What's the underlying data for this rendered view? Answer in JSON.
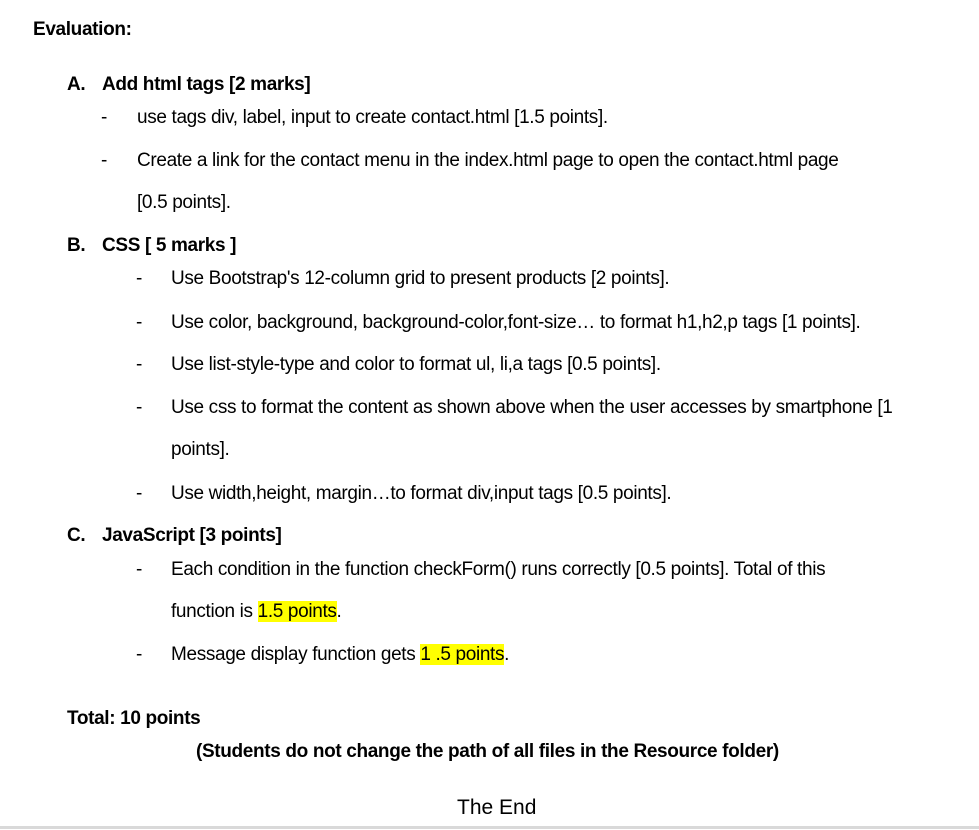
{
  "heading": "Evaluation:",
  "section_a": {
    "label": "A.",
    "title": "Add html tags [2 marks]",
    "items": [
      "use tags div, label, input to create contact.html [1.5 points].",
      "Create a link for the contact menu in the index.html page  to open the contact.html page",
      "[0.5 points]."
    ]
  },
  "section_b": {
    "label": "B.",
    "title": "CSS  [ 5 marks ]",
    "items": [
      "Use Bootstrap's 12-column grid to present products [2 points].",
      "Use color, background, background-color,font-size… to format h1,h2,p tags [1 points].",
      "Use list-style-type and color to format ul, li,a tags [0.5 points].",
      "Use css to format the content as shown above when the user accesses by smartphone [1",
      "points].",
      "Use width,height, margin…to format div,input  tags [0.5 points]."
    ]
  },
  "section_c": {
    "label": "C.",
    "title": "JavaScript [3 points]",
    "item1_line1": "Each condition in the function checkForm() runs correctly [0.5 points]. Total of this",
    "item1_line2_prefix": "function is ",
    "item1_line2_highlight": "1.5 points",
    "item1_line2_suffix": ".",
    "item2_prefix": "Message display function gets ",
    "item2_highlight": "1 .5 points",
    "item2_suffix": "."
  },
  "total": "Total: 10 points",
  "note": "(Students do not change the path of all files in the Resource folder)",
  "the_end": "The End",
  "colors": {
    "highlight": "#ffff00",
    "text": "#000000",
    "rule": "#d9d9d9"
  }
}
